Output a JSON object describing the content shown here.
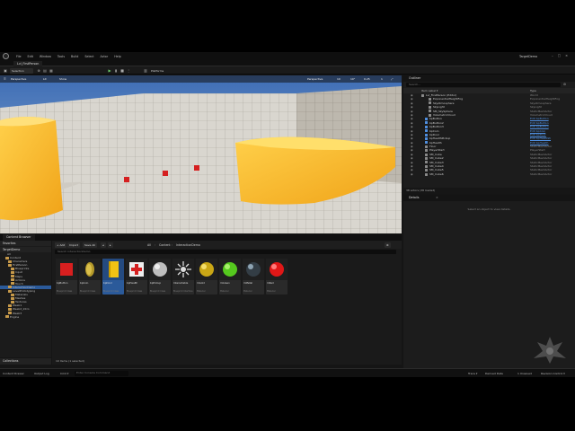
{
  "titlebar": {
    "menus": [
      "File",
      "Edit",
      "Window",
      "Tools",
      "Build",
      "Select",
      "Actor",
      "Help"
    ],
    "project_name": "TargetDemo",
    "minimize": "–",
    "maximize": "□",
    "close": "×"
  },
  "level_tab": {
    "label": "Lvl_FirstPerson"
  },
  "toolbar": {
    "save_icon": "💾",
    "mode_label": "Selection Mode",
    "platforms_label": "Platforms"
  },
  "viewport": {
    "perspective_label": "Perspective",
    "lit_label": "Lit",
    "show_label": "Show",
    "right_label": "Perspective",
    "grid_value": "10",
    "angle_value": "10°",
    "scale_value": "0.25",
    "speed_value": "1"
  },
  "outliner": {
    "title": "Outliner",
    "search_placeholder": "Search...",
    "col_label": "Item Label ▾",
    "col_type": "Type",
    "rows": [
      {
        "name": "Lvl_FirstPerson (Editor)",
        "type": "World",
        "indent": 0,
        "link": false
      },
      {
        "name": "ExponentialHeightFog",
        "type": "ExponentialHeightFog",
        "indent": 2,
        "link": false
      },
      {
        "name": "SkyAtmosphere",
        "type": "SkyAtmosphere",
        "indent": 2,
        "link": false
      },
      {
        "name": "SkyLight",
        "type": "SkyLight",
        "indent": 2,
        "link": false
      },
      {
        "name": "SM_SkySphere",
        "type": "StaticMeshActor",
        "indent": 2,
        "link": false
      },
      {
        "name": "VolumetricCloud",
        "type": "VolumetricCloud",
        "indent": 2,
        "link": false
      },
      {
        "name": "bpButton",
        "type": "Edit bpButton",
        "indent": 1,
        "link": true
      },
      {
        "name": "bpButton2",
        "type": "Edit bpButton",
        "indent": 1,
        "link": true
      },
      {
        "name": "bpButton3",
        "type": "Edit bpButton",
        "indent": 1,
        "link": true
      },
      {
        "name": "bpCoin",
        "type": "Edit bpCoin",
        "indent": 1,
        "link": true
      },
      {
        "name": "bpDoor",
        "type": "Edit bpDoor",
        "indent": 1,
        "link": true
      },
      {
        "name": "bpHealthPickup",
        "type": "Edit bpHealthPi",
        "indent": 1,
        "link": true
      },
      {
        "name": "bpHealth",
        "type": "Edit bpHealth",
        "indent": 1,
        "link": true
      },
      {
        "name": "Floor",
        "type": "StaticMeshActor",
        "indent": 1,
        "link": false
      },
      {
        "name": "PlayerStart",
        "type": "PlayerStart",
        "indent": 1,
        "link": false
      },
      {
        "name": "SM_Cube",
        "type": "StaticMeshActor",
        "indent": 1,
        "link": false
      },
      {
        "name": "SM_Cube2",
        "type": "StaticMeshActor",
        "indent": 1,
        "link": false
      },
      {
        "name": "SM_Cube3",
        "type": "StaticMeshActor",
        "indent": 1,
        "link": false
      },
      {
        "name": "SM_Cube4",
        "type": "StaticMeshActor",
        "indent": 1,
        "link": false
      },
      {
        "name": "SM_Cube5",
        "type": "StaticMeshActor",
        "indent": 1,
        "link": false
      },
      {
        "name": "SM_Cube6",
        "type": "StaticMeshActor",
        "indent": 1,
        "link": false
      }
    ],
    "footer": "38 actors (38 loaded)"
  },
  "details": {
    "title": "Details",
    "close": "×",
    "empty_text": "Select an object to view details."
  },
  "content_browser": {
    "tab_label": "Content Browser",
    "add_label": "+ Add",
    "import_label": "Import",
    "save_all_label": "Save All",
    "path": [
      "All",
      "Content",
      "InteractionDemo"
    ],
    "search_placeholder": "Search InteractionDemo",
    "favorites_label": "Favorites",
    "project_label": "TargetDemo",
    "collections_label": "Collections",
    "status_text": "10 items (1 selected)",
    "tree": [
      {
        "label": "All",
        "indent": 0,
        "folder": false
      },
      {
        "label": "Content",
        "indent": 1,
        "folder": true
      },
      {
        "label": "Characters",
        "indent": 2,
        "folder": true
      },
      {
        "label": "FirstPerson",
        "indent": 2,
        "folder": true
      },
      {
        "label": "Blueprints",
        "indent": 3,
        "folder": true
      },
      {
        "label": "Input",
        "indent": 3,
        "folder": true
      },
      {
        "label": "Maps",
        "indent": 3,
        "folder": true
      },
      {
        "label": "Actions",
        "indent": 3,
        "folder": true
      },
      {
        "label": "Touch",
        "indent": 3,
        "folder": true
      },
      {
        "label": "InteractionDemo",
        "indent": 2,
        "folder": true,
        "selected": true
      },
      {
        "label": "LevelPrototyping",
        "indent": 2,
        "folder": true
      },
      {
        "label": "Materials",
        "indent": 3,
        "folder": true
      },
      {
        "label": "Meshes",
        "indent": 3,
        "folder": true
      },
      {
        "label": "Textures",
        "indent": 3,
        "folder": true
      },
      {
        "label": "Week1",
        "indent": 2,
        "folder": true
      },
      {
        "label": "Week2_Intro",
        "indent": 2,
        "folder": true
      },
      {
        "label": "Week3",
        "indent": 2,
        "folder": true
      },
      {
        "label": "Engine",
        "indent": 1,
        "folder": true
      }
    ],
    "assets": [
      {
        "name": "bpButton",
        "type": "Blueprint Class",
        "thumb": "red-cube"
      },
      {
        "name": "bpCoin",
        "type": "Blueprint Class",
        "thumb": "coin"
      },
      {
        "name": "bpDoor",
        "type": "Blueprint Class",
        "thumb": "door",
        "selected": true
      },
      {
        "name": "bpHealth",
        "type": "Blueprint Class",
        "thumb": "health"
      },
      {
        "name": "bpPickup",
        "type": "Blueprint Class",
        "thumb": "sphere-grey"
      },
      {
        "name": "Interactable",
        "type": "Blueprint Interface",
        "thumb": "interface"
      },
      {
        "name": "mGold",
        "type": "Material",
        "thumb": "sphere-gold"
      },
      {
        "name": "mGreen",
        "type": "Material",
        "thumb": "sphere-green"
      },
      {
        "name": "mMetal",
        "type": "Material",
        "thumb": "sphere-dark"
      },
      {
        "name": "mRed",
        "type": "Material",
        "thumb": "sphere-red"
      }
    ]
  },
  "bottombar": {
    "content_drawer": "Content Drawer",
    "output_log": "Output Log",
    "cmd_label": "Cmd ▾",
    "cmd_placeholder": "Enter Console Command",
    "trace": "Trace ▾",
    "derived": "Derived Data",
    "unsaved": "1 Unsaved",
    "revision": "Revision Control ▾"
  },
  "colors": {
    "accent_selected": "#2b5a9a",
    "link": "#4f8fe0",
    "floor_tile": "#d8d4cc",
    "gold": "#f6b82a"
  }
}
